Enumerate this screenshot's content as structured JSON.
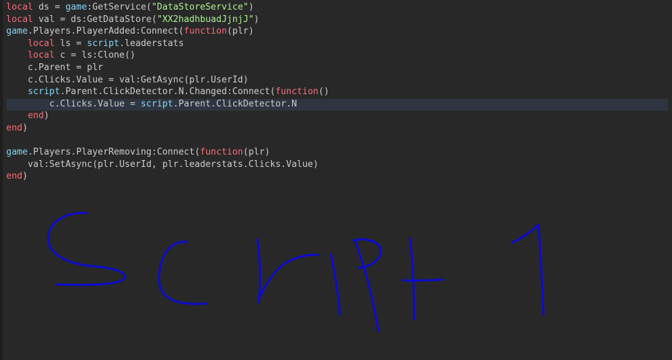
{
  "editor": {
    "theme": {
      "background": "#282828",
      "keyword": "#f86d7c",
      "builtin": "#84d6f7",
      "string": "#adf195",
      "text": "#cccccc",
      "current_line": "#2e3541",
      "ink": "#0b0bd1"
    },
    "handwriting": "Script 1",
    "lines": [
      [
        [
          "kw",
          "local"
        ],
        [
          "t",
          " ds = "
        ],
        [
          "bi",
          "game"
        ],
        [
          "t",
          ":GetService("
        ],
        [
          "str",
          "\"DataStoreService\""
        ],
        [
          "t",
          ")"
        ]
      ],
      [
        [
          "kw",
          "local"
        ],
        [
          "t",
          " val = ds:GetDataStore("
        ],
        [
          "str",
          "\"XX2hadhbuadJjnjJ\""
        ],
        [
          "t",
          ")"
        ]
      ],
      [
        [
          "bi",
          "game"
        ],
        [
          "t",
          ".Players.PlayerAdded:Connect("
        ],
        [
          "kw",
          "function"
        ],
        [
          "t",
          "(plr)"
        ]
      ],
      [
        [
          "t",
          "    "
        ],
        [
          "kw",
          "local"
        ],
        [
          "t",
          " ls = "
        ],
        [
          "bi",
          "script"
        ],
        [
          "t",
          ".leaderstats"
        ]
      ],
      [
        [
          "t",
          "    "
        ],
        [
          "kw",
          "local"
        ],
        [
          "t",
          " c = ls:Clone()"
        ]
      ],
      [
        [
          "t",
          "    c.Parent = plr"
        ]
      ],
      [
        [
          "t",
          "    c.Clicks.Value = val:GetAsync(plr.UserId)"
        ]
      ],
      [
        [
          "t",
          "    "
        ],
        [
          "bi",
          "script"
        ],
        [
          "t",
          ".Parent.ClickDetector.N.Changed:Connect("
        ],
        [
          "kw",
          "function"
        ],
        [
          "t",
          "()"
        ]
      ],
      [
        [
          "t",
          "        c.Clicks.Value = "
        ],
        [
          "bi",
          "script"
        ],
        [
          "t",
          ".Parent.ClickDetector.N"
        ]
      ],
      [
        [
          "t",
          "    "
        ],
        [
          "kw",
          "end"
        ],
        [
          "t",
          ")"
        ]
      ],
      [
        [
          "kw",
          "end"
        ],
        [
          "t",
          ")"
        ]
      ],
      [
        [
          "t",
          ""
        ]
      ],
      [
        [
          "bi",
          "game"
        ],
        [
          "t",
          ".Players.PlayerRemoving:Connect("
        ],
        [
          "kw",
          "function"
        ],
        [
          "t",
          "(plr)"
        ]
      ],
      [
        [
          "t",
          "    val:SetAsync(plr.UserId, plr.leaderstats.Clicks.Value)"
        ]
      ],
      [
        [
          "kw",
          "end"
        ],
        [
          "t",
          ")"
        ]
      ]
    ]
  }
}
